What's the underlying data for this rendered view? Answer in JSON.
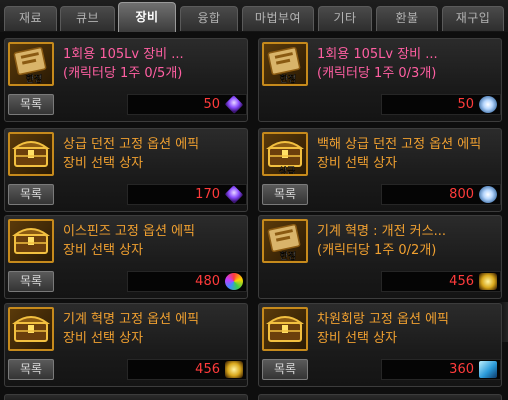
{
  "tabs": [
    {
      "label": "재료",
      "active": false
    },
    {
      "label": "큐브",
      "active": false
    },
    {
      "label": "장비",
      "active": true
    },
    {
      "label": "융합",
      "active": false
    },
    {
      "label": "마법부여",
      "active": false
    },
    {
      "label": "기타",
      "active": false
    },
    {
      "label": "환불",
      "active": false
    },
    {
      "label": "재구입",
      "active": false
    }
  ],
  "items": [
    {
      "title_line1": "1회용 105Lv 장비 ...",
      "title_line2": "(캐릭터당 1주 0/5개)",
      "title_color": "pink",
      "icon": "equipment-ticket-icon",
      "badge": "한정",
      "list_label": "목록",
      "price": "50",
      "currency_icon": "purple-spirit-stone-icon"
    },
    {
      "title_line1": "1회용 105Lv 장비 ...",
      "title_line2": "(캐릭터당 1주 0/3개)",
      "title_color": "pink",
      "icon": "equipment-ticket-icon",
      "badge": "한정",
      "list_label": "",
      "price": "50",
      "currency_icon": "white-crystal-icon"
    },
    {
      "title_line1": "상급 던전 고정 옵션 에픽",
      "title_line2": "장비 선택 상자",
      "title_color": "gold",
      "icon": "treasure-chest-icon",
      "badge": "",
      "list_label": "목록",
      "price": "170",
      "currency_icon": "purple-spirit-stone-icon"
    },
    {
      "title_line1": "백해 상급 던전 고정 옵션 에픽",
      "title_line2": "장비 선택 상자",
      "title_color": "gold",
      "icon": "treasure-chest-icon",
      "badge": "상급",
      "list_label": "목록",
      "price": "800",
      "currency_icon": "white-crystal-icon"
    },
    {
      "title_line1": "이스핀즈 고정 옵션 에픽",
      "title_line2": "장비 선택 상자",
      "title_color": "gold",
      "icon": "treasure-chest-icon",
      "badge": "",
      "list_label": "목록",
      "price": "480",
      "currency_icon": "mixed-gem-icon"
    },
    {
      "title_line1": "기계 혁명 : 개전 커스...",
      "title_line2": "(캐릭터당 1주 0/2개)",
      "title_color": "gold",
      "icon": "equipment-ticket-icon",
      "badge": "한정",
      "list_label": "",
      "price": "456",
      "currency_icon": "gear-part-icon"
    },
    {
      "title_line1": "기계 혁명 고정 옵션 에픽",
      "title_line2": "장비 선택 상자",
      "title_color": "gold",
      "icon": "treasure-chest-icon",
      "badge": "",
      "list_label": "목록",
      "price": "456",
      "currency_icon": "gear-part-icon"
    },
    {
      "title_line1": "차원회랑 고정 옵션 에픽",
      "title_line2": "장비 선택 상자",
      "title_color": "gold",
      "icon": "treasure-chest-icon",
      "badge": "",
      "list_label": "목록",
      "price": "360",
      "currency_icon": "blue-cube-icon"
    }
  ]
}
